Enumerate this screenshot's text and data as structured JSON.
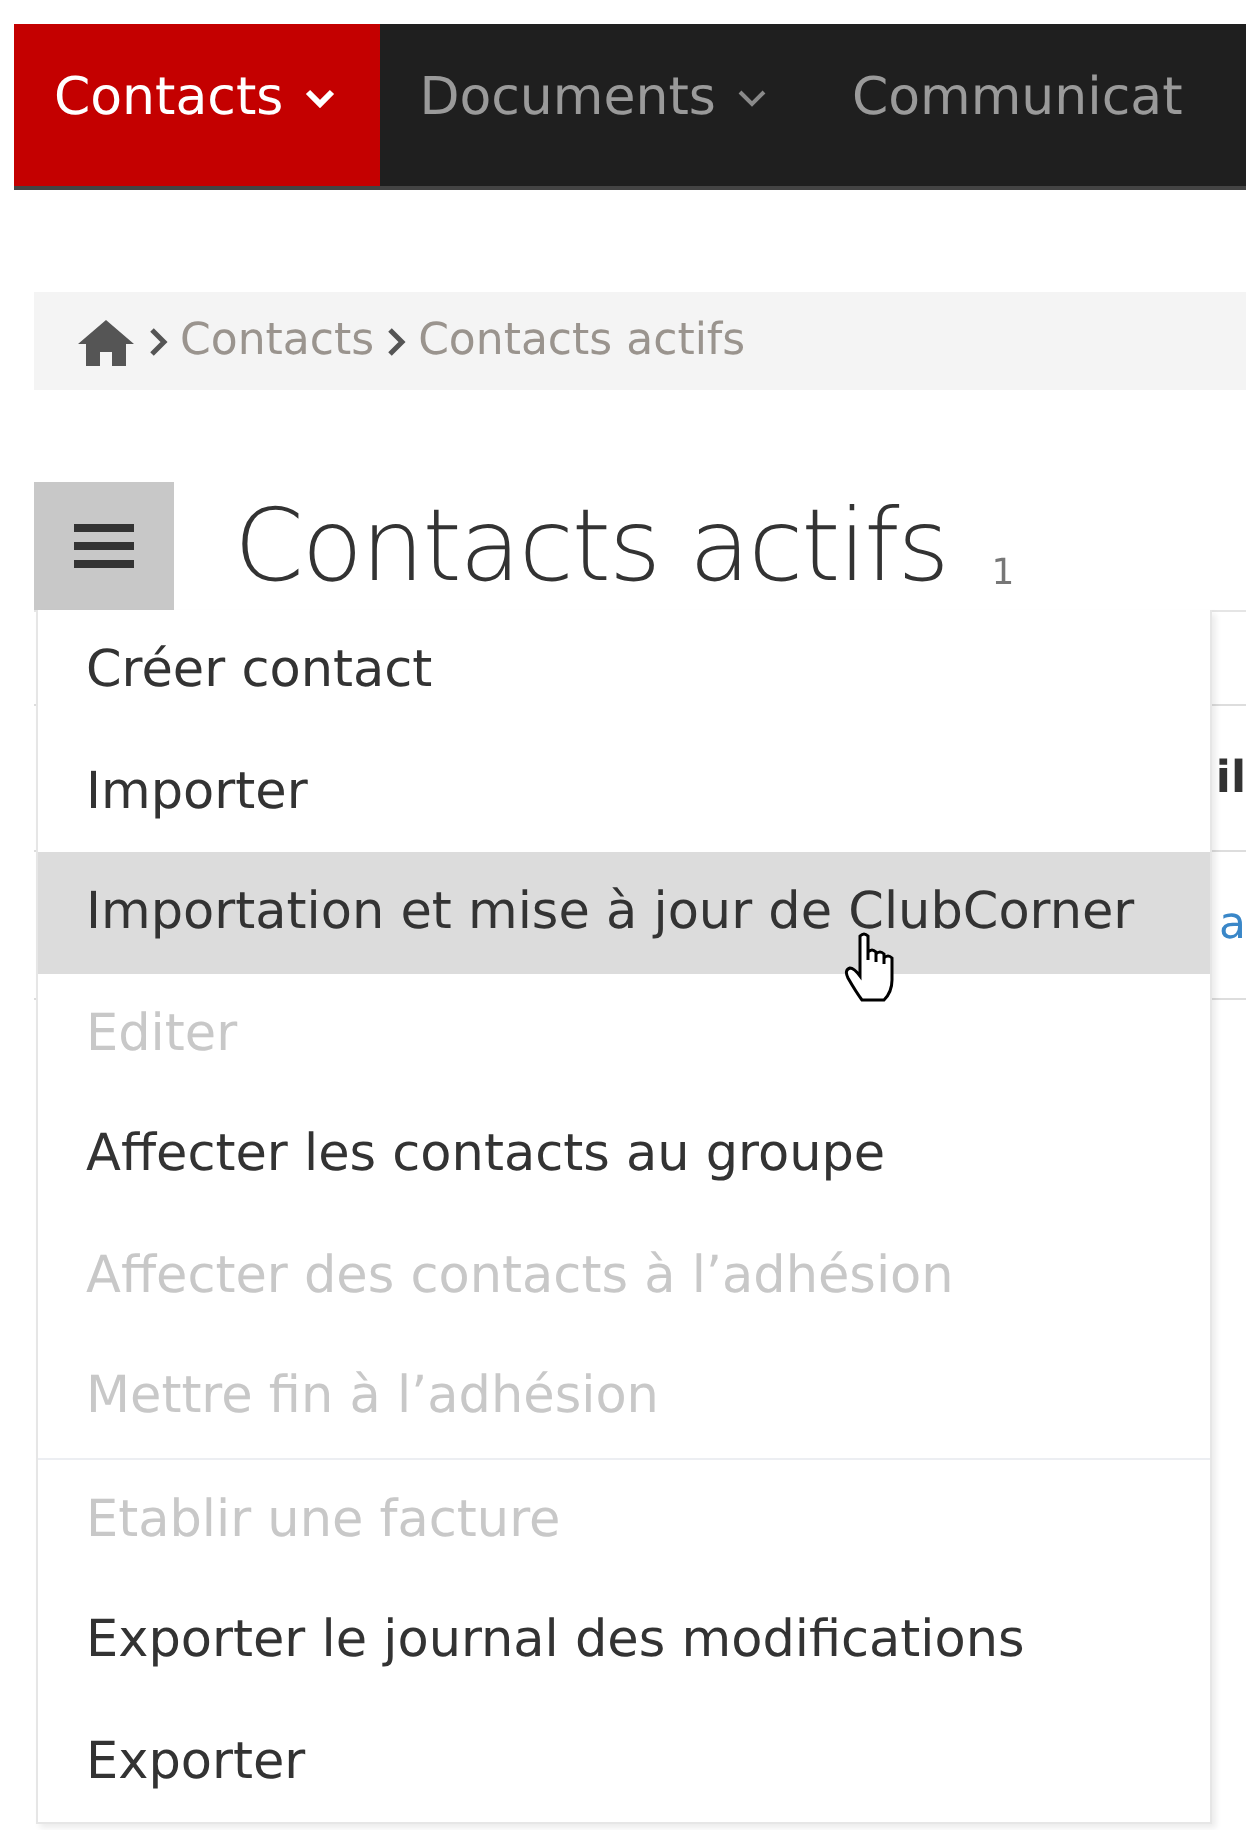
{
  "nav": {
    "tabs": [
      {
        "label": "Contacts",
        "selected": true
      },
      {
        "label": "Documents",
        "selected": false
      },
      {
        "label": "Communicat",
        "selected": false
      }
    ]
  },
  "breadcrumb": {
    "items": [
      "Contacts",
      "Contacts actifs"
    ]
  },
  "page": {
    "title": "Contacts actifs",
    "count": "1"
  },
  "actions_menu": {
    "open": true,
    "items": [
      {
        "label": "Créer contact",
        "disabled": false,
        "selected": false
      },
      {
        "label": "Importer",
        "disabled": false,
        "selected": false
      },
      {
        "label": "Importation et mise à jour de ClubCorner",
        "disabled": false,
        "selected": true
      },
      {
        "label": "Editer",
        "disabled": true,
        "selected": false
      },
      {
        "label": "Affecter les contacts au groupe",
        "disabled": false,
        "selected": false
      },
      {
        "label": "Affecter des contacts à l’adhésion",
        "disabled": true,
        "selected": false
      },
      {
        "label": "Mettre fin à l’adhésion",
        "disabled": true,
        "selected": false,
        "divider_after": true
      },
      {
        "label": "Etablir une facture",
        "disabled": true,
        "selected": false
      },
      {
        "label": "Exporter le journal des modifications",
        "disabled": false,
        "selected": false
      },
      {
        "label": "Exporter",
        "disabled": false,
        "selected": false
      }
    ]
  },
  "table": {
    "columns": [
      "il"
    ],
    "rows": [
      [
        "a"
      ]
    ]
  }
}
